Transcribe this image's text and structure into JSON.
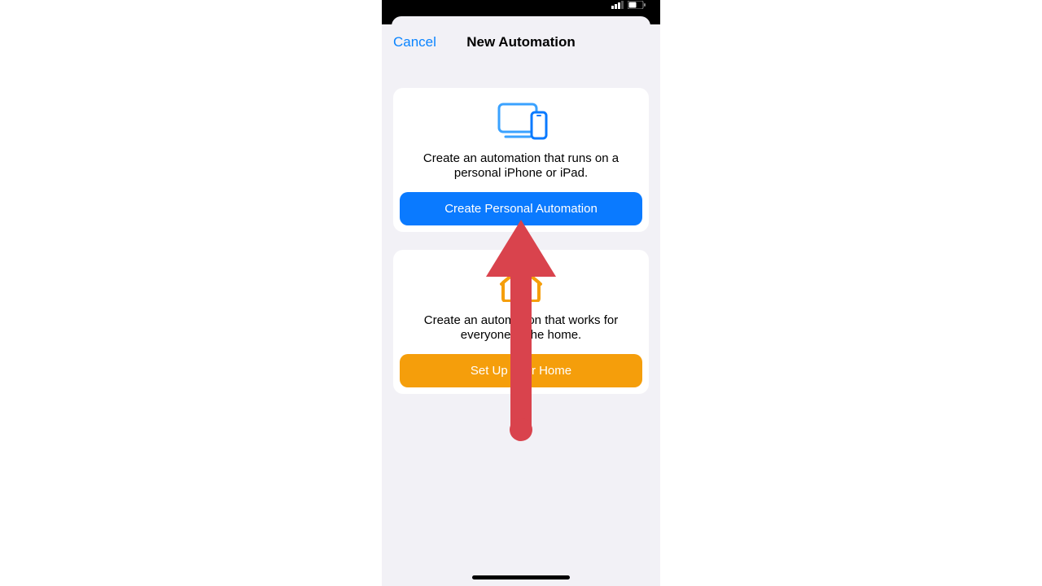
{
  "statusbar": {
    "signal": "•••",
    "battery": "□"
  },
  "header": {
    "cancel": "Cancel",
    "title": "New Automation"
  },
  "cards": {
    "personal": {
      "description": "Create an automation that runs on a personal iPhone or iPad.",
      "button": "Create Personal Automation"
    },
    "home": {
      "description": "Create an automation that works for everyone in the home.",
      "button": "Set Up Your Home"
    }
  },
  "colors": {
    "accent_blue": "#0a7aff",
    "accent_orange": "#f59e0b",
    "link_blue": "#0a84ff",
    "arrow_red": "#d9434d"
  },
  "icons": {
    "personal": "devices-icon",
    "home": "home-icon"
  }
}
